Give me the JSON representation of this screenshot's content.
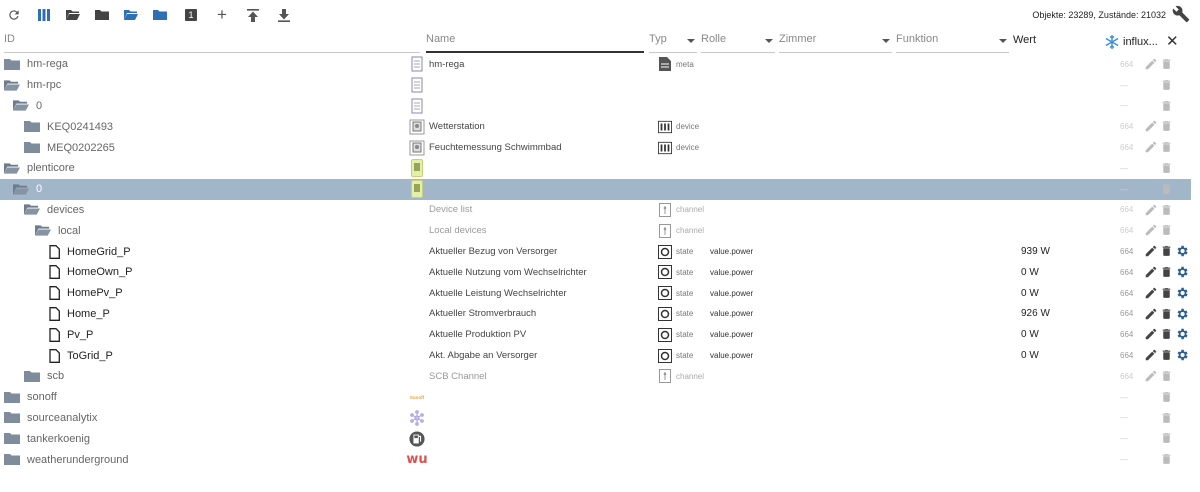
{
  "toolbar": {
    "buttons": [
      {
        "name": "refresh-icon"
      },
      {
        "name": "columns-icon"
      },
      {
        "name": "folder-open-icon"
      },
      {
        "name": "folder-icon"
      },
      {
        "name": "folder-open-blue-icon"
      },
      {
        "name": "folder-blue-icon"
      },
      {
        "name": "badge-one-icon",
        "label": "1"
      },
      {
        "name": "add-icon",
        "label": "+"
      },
      {
        "name": "upload-icon"
      },
      {
        "name": "download-icon"
      }
    ],
    "objects_info": "Objekte: 23289, Zustände: 21032"
  },
  "header": {
    "id_placeholder": "ID",
    "name_placeholder": "Name",
    "typ_label": "Typ",
    "rolle_label": "Rolle",
    "zimmer_label": "Zimmer",
    "funktion_label": "Funktion",
    "wert_label": "Wert",
    "history_label": "influx..."
  },
  "colors": {
    "folder": "#7f8c9c",
    "folder_dark": "#5f6b7a",
    "selected_row": "#a2b6ca",
    "icon": "#444444"
  },
  "rows": [
    {
      "label": "hm-rega",
      "indent": 0,
      "kind": "folder",
      "icon": "doc-icon",
      "name": "hm-rega",
      "type": "meta",
      "typeIcon": "meta",
      "acl": "664",
      "aclDim": true,
      "actions": "pencil-trash-dim"
    },
    {
      "label": "hm-rpc",
      "indent": 0,
      "kind": "folder-open",
      "icon": "doc-icon",
      "name": "",
      "type": "",
      "acl": "—",
      "actions": "trash"
    },
    {
      "label": "0",
      "indent": 1,
      "kind": "folder-open",
      "icon": "doc-icon",
      "name": "",
      "type": "",
      "acl": "—",
      "actions": "trash"
    },
    {
      "label": "KEQ0241493",
      "indent": 2,
      "kind": "folder",
      "icon": "device-icon",
      "name": "Wetterstation",
      "type": "device",
      "typeIcon": "device",
      "acl": "664",
      "aclDim": true,
      "actions": "pencil-trash-dim"
    },
    {
      "label": "MEQ0202265",
      "indent": 2,
      "kind": "folder",
      "icon": "device-icon",
      "name": "Feuchtemessung Schwimmbad",
      "type": "device",
      "typeIcon": "device",
      "acl": "664",
      "aclDim": true,
      "actions": "pencil-trash-dim"
    },
    {
      "label": "plenticore",
      "indent": 0,
      "kind": "folder-open",
      "icon": "battery-icon",
      "name": "",
      "type": "",
      "acl": "—",
      "actions": "trash"
    },
    {
      "label": "0",
      "indent": 1,
      "kind": "folder-open",
      "icon": "battery-icon",
      "name": "",
      "type": "",
      "acl": "—",
      "actions": "trash",
      "selected": true
    },
    {
      "label": "devices",
      "indent": 2,
      "kind": "folder-open",
      "icon": "",
      "name": "Device list",
      "nameLight": true,
      "type": "channel",
      "typeIcon": "channel",
      "typeLight": true,
      "acl": "664",
      "aclDim": true,
      "actions": "pencil-trash-dim"
    },
    {
      "label": "local",
      "indent": 3,
      "kind": "folder-open",
      "icon": "",
      "name": "Local devices",
      "nameLight": true,
      "type": "channel",
      "typeIcon": "channel",
      "typeLight": true,
      "acl": "664",
      "aclDim": true,
      "actions": "pencil-trash-dim"
    },
    {
      "label": "HomeGrid_P",
      "indent": 4,
      "kind": "file",
      "icon": "",
      "name": "Aktueller Bezug von Versorger",
      "type": "state",
      "typeIcon": "state",
      "role": "value.power",
      "value": "939 W",
      "acl": "664",
      "actions": "full"
    },
    {
      "label": "HomeOwn_P",
      "indent": 4,
      "kind": "file",
      "icon": "",
      "name": "Aktuelle Nutzung vom Wechselrichter",
      "type": "state",
      "typeIcon": "state",
      "role": "value.power",
      "value": "0 W",
      "acl": "664",
      "actions": "full"
    },
    {
      "label": "HomePv_P",
      "indent": 4,
      "kind": "file",
      "icon": "",
      "name": "Aktuelle Leistung Wechselrichter",
      "type": "state",
      "typeIcon": "state",
      "role": "value.power",
      "value": "0 W",
      "acl": "664",
      "actions": "full"
    },
    {
      "label": "Home_P",
      "indent": 4,
      "kind": "file",
      "icon": "",
      "name": "Aktueller Stromverbrauch",
      "type": "state",
      "typeIcon": "state",
      "role": "value.power",
      "value": "926 W",
      "acl": "664",
      "actions": "full"
    },
    {
      "label": "Pv_P",
      "indent": 4,
      "kind": "file",
      "icon": "",
      "name": "Aktuelle Produktion PV",
      "type": "state",
      "typeIcon": "state",
      "role": "value.power",
      "value": "0 W",
      "acl": "664",
      "actions": "full"
    },
    {
      "label": "ToGrid_P",
      "indent": 4,
      "kind": "file",
      "icon": "",
      "name": "Akt. Abgabe an Versorger",
      "type": "state",
      "typeIcon": "state",
      "role": "value.power",
      "value": "0 W",
      "acl": "664",
      "actions": "full"
    },
    {
      "label": "scb",
      "indent": 2,
      "kind": "folder",
      "icon": "",
      "name": "SCB Channel",
      "nameLight": true,
      "type": "channel",
      "typeIcon": "channel",
      "typeLight": true,
      "acl": "664",
      "aclDim": true,
      "actions": "pencil-trash-dim"
    },
    {
      "label": "sonoff",
      "indent": 0,
      "kind": "folder",
      "icon": "sonoff-logo",
      "name": "",
      "type": "",
      "acl": "—",
      "actions": "trash",
      "logoText": "Sonoff"
    },
    {
      "label": "sourceanalytix",
      "indent": 0,
      "kind": "folder",
      "icon": "network-icon",
      "name": "",
      "type": "",
      "acl": "—",
      "actions": "trash"
    },
    {
      "label": "tankerkoenig",
      "indent": 0,
      "kind": "folder",
      "icon": "fuel-icon",
      "name": "",
      "type": "",
      "acl": "—",
      "actions": "trash"
    },
    {
      "label": "weatherunderground",
      "indent": 0,
      "kind": "folder",
      "icon": "wu-logo",
      "name": "",
      "type": "",
      "acl": "—",
      "actions": "trash",
      "logoText": "wu"
    }
  ]
}
